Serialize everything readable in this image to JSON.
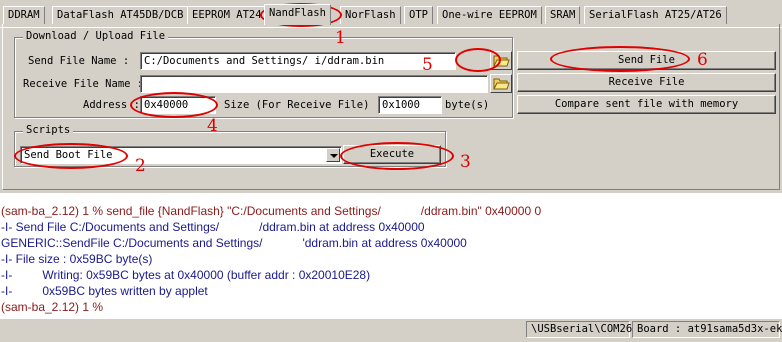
{
  "tabs": [
    "DDRAM",
    "DataFlash AT45DB/DCB",
    "EEPROM AT24",
    "NandFlash",
    "NorFlash",
    "OTP",
    "One-wire EEPROM",
    "SRAM",
    "SerialFlash AT25/AT26"
  ],
  "active_tab": "NandFlash",
  "download_group": {
    "title": "Download / Upload File",
    "send_file_label": "Send File Name :",
    "send_file_value": "C:/Documents and Settings/            i/ddram.bin",
    "receive_file_label": "Receive File Name :",
    "receive_file_value": "",
    "address_label": "Address :",
    "address_value": "0x40000",
    "size_label": "Size (For Receive File) :",
    "size_value": "0x1000",
    "size_unit": "byte(s)",
    "send_button": "Send File",
    "receive_button": "Receive File",
    "compare_button": "Compare sent file with memory"
  },
  "scripts_group": {
    "title": "Scripts",
    "selected_script": "Send Boot File",
    "execute_button": "Execute"
  },
  "annotations": [
    "1",
    "2",
    "3",
    "4",
    "5",
    "6"
  ],
  "console": {
    "lines": [
      {
        "text": "(sam-ba_2.12) 1 % send_file {NandFlash} \"C:/Documents and Settings/            /ddram.bin\" 0x40000 0",
        "kind": "prompt"
      },
      {
        "text": "-I- Send File C:/Documents and Settings/            /ddram.bin at address 0x40000",
        "kind": "info"
      },
      {
        "text": "GENERIC::SendFile C:/Documents and Settings/            'ddram.bin at address 0x40000",
        "kind": "info"
      },
      {
        "text": "-I- File size : 0x59BC byte(s)",
        "kind": "info"
      },
      {
        "text": "-I-         Writing: 0x59BC bytes at 0x40000 (buffer addr : 0x20010E28)",
        "kind": "info"
      },
      {
        "text": "-I-         0x59BC bytes written by applet",
        "kind": "info"
      },
      {
        "text": "(sam-ba_2.12) 1 %",
        "kind": "prompt"
      }
    ]
  },
  "status_bar": {
    "connection": "\\USBserial\\COM26",
    "board": "Board : at91sama5d3x-ek"
  },
  "colors": {
    "annotation_red": "#e00000",
    "console_prompt": "#8b1a1a",
    "console_info": "#1a1a8c"
  }
}
